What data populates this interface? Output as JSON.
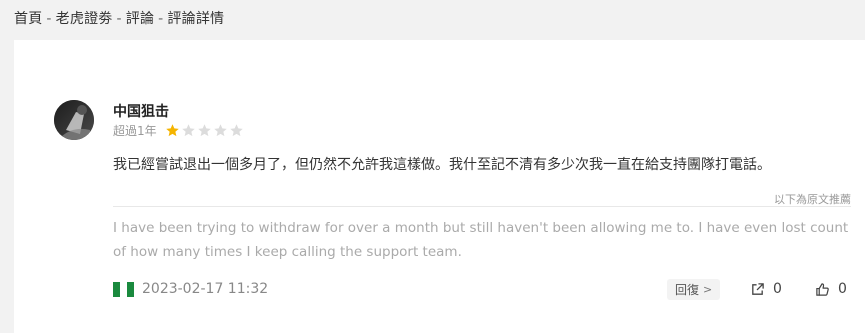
{
  "breadcrumb": {
    "items": [
      "首頁",
      "老虎證劵",
      "評論",
      "評論詳情"
    ],
    "separator": "-"
  },
  "review": {
    "user": {
      "name": "中国狙击",
      "avatar_icon": "avatar-photo"
    },
    "time_ago": "超過1年",
    "rating": {
      "value": 1,
      "max": 5,
      "filled_color": "#f5b400",
      "empty_color": "#dcdcdc"
    },
    "text": "我已經嘗試退出一個多月了，但仍然不允許我這樣做。我什至記不清有多少次我一直在給支持團隊打電話。",
    "original_note": "以下為原文推薦",
    "original_text": "I have been trying to withdraw for over a month but still haven't been allowing me to. I have even lost count of how many times I keep calling the support team.",
    "flag": {
      "icon": "nigeria-flag-icon",
      "colors": [
        "#1a8a3e",
        "#ffffff",
        "#1a8a3e"
      ]
    },
    "date": "2023-02-17 11:32",
    "reply_label": "回復",
    "reply_chevron": ">",
    "share_count": "0",
    "like_count": "0"
  }
}
